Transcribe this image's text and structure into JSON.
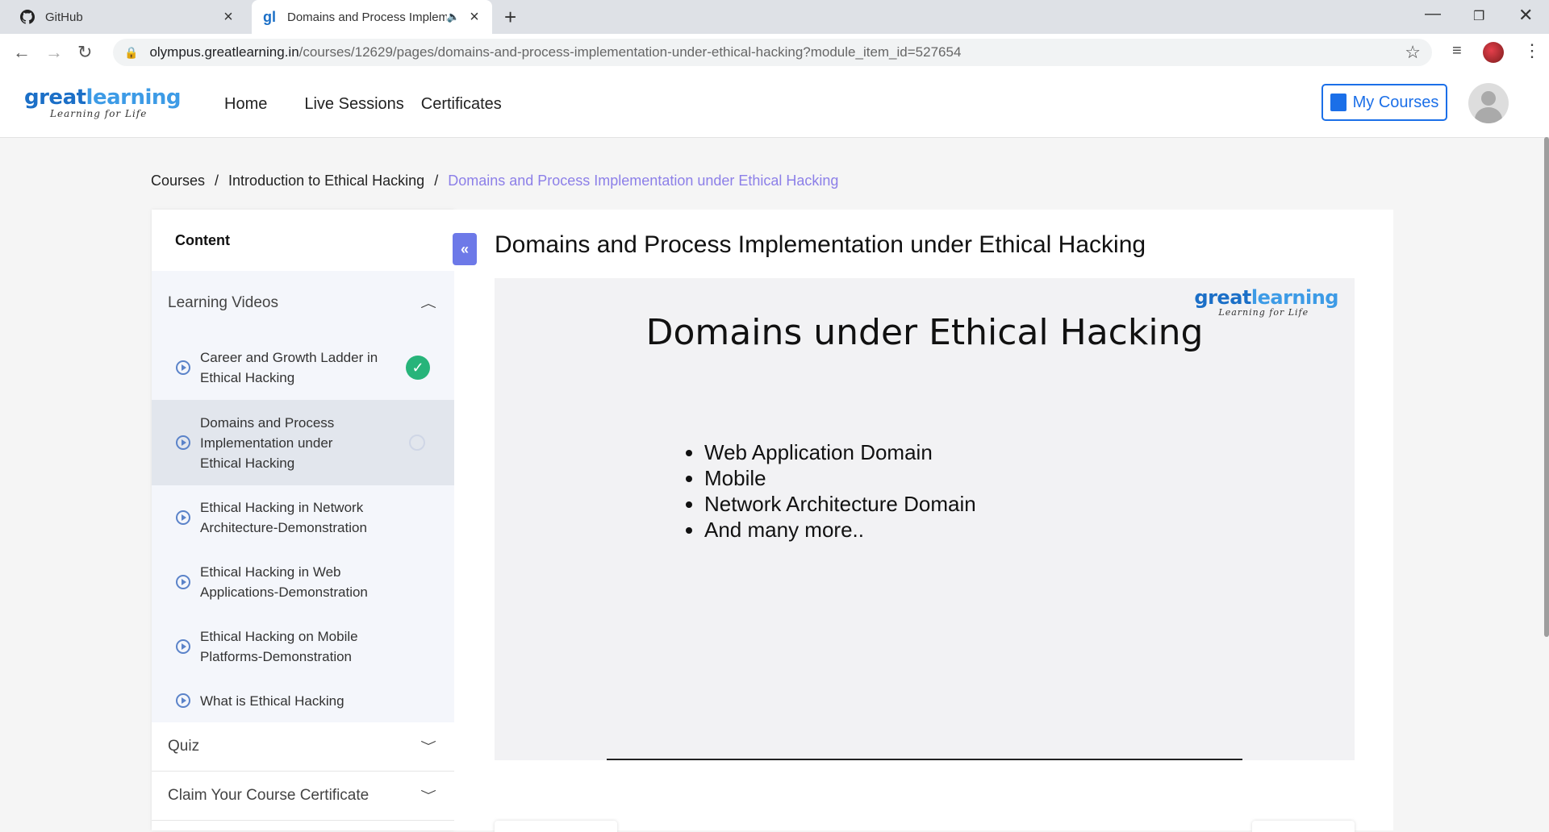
{
  "browser": {
    "tabs": [
      {
        "title": "GitHub",
        "icon": "github-icon"
      },
      {
        "title": "Domains and Process Implem",
        "icon": "greatlearning-icon",
        "audio": true
      }
    ],
    "url_host": "olympus.greatlearning.in",
    "url_path": "/courses/12629/pages/domains-and-process-implementation-under-ethical-hacking?module_item_id=527654"
  },
  "header": {
    "logo_great": "great",
    "logo_learning": "learning",
    "logo_tagline": "Learning for Life",
    "nav": [
      "Home",
      "Live Sessions",
      "Certificates"
    ],
    "my_courses": "My Courses"
  },
  "breadcrumb": {
    "items": [
      "Courses",
      "Introduction to Ethical Hacking",
      "Domains and Process Implementation under Ethical Hacking"
    ],
    "separator": "/"
  },
  "sidebar": {
    "title": "Content",
    "section_open": "Learning Videos",
    "items": [
      {
        "label": "Career and Growth Ladder in Ethical Hacking",
        "status": "completed"
      },
      {
        "label": "Domains and Process Implementation under Ethical Hacking",
        "status": "in-progress"
      },
      {
        "label": "Ethical Hacking in Network Architecture-Demonstration",
        "status": ""
      },
      {
        "label": "Ethical Hacking in Web Applications-Demonstration",
        "status": ""
      },
      {
        "label": "Ethical Hacking on Mobile Platforms-Demonstration",
        "status": ""
      },
      {
        "label": "What is Ethical Hacking",
        "status": ""
      }
    ],
    "section_quiz": "Quiz",
    "section_certificate": "Claim Your Course Certificate"
  },
  "main": {
    "title": "Domains and Process Implementation under Ethical Hacking",
    "slide": {
      "title": "Domains under Ethical Hacking",
      "bullets": [
        "Web Application Domain",
        "Mobile",
        "Network Architecture Domain",
        "And many more.."
      ]
    }
  },
  "colors": {
    "accent": "#1b6fe8",
    "breadcrumb_current": "#8c7fe8",
    "completed": "#27b47a",
    "collapse_button": "#6d79e8"
  }
}
